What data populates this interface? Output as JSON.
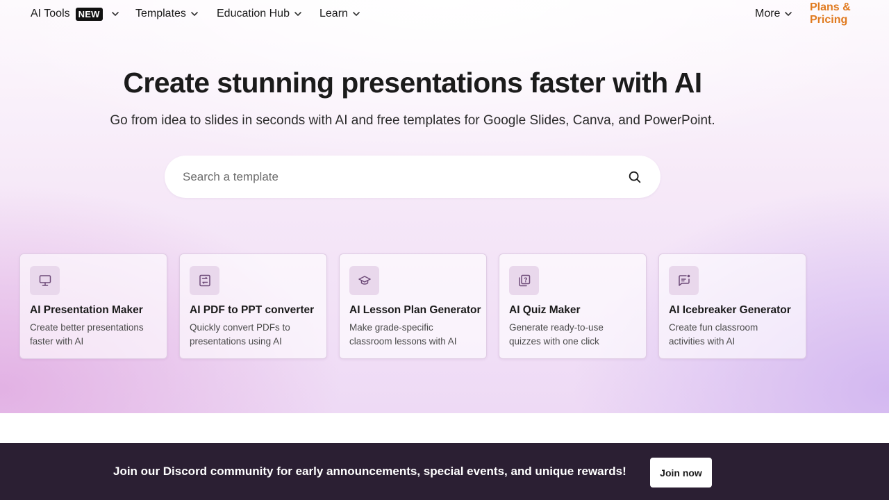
{
  "nav": {
    "ai_tools": "AI Tools",
    "new_badge": "NEW",
    "templates": "Templates",
    "education_hub": "Education Hub",
    "learn": "Learn",
    "more": "More",
    "pricing": "Plans & Pricing"
  },
  "hero": {
    "headline": "Create stunning presentations faster with AI",
    "subhead": "Go from idea to slides in seconds with AI and free templates for Google Slides, Canva, and PowerPoint."
  },
  "search": {
    "placeholder": "Search a template"
  },
  "cards": [
    {
      "title": "AI Presentation Maker",
      "desc": "Create better presentations faster with AI",
      "icon": "monitor-icon"
    },
    {
      "title": "AI PDF to PPT converter",
      "desc": "Quickly convert PDFs to presentations using AI",
      "icon": "convert-document-icon"
    },
    {
      "title": "AI Lesson Plan Generator",
      "desc": "Make grade-specific classroom lessons with AI",
      "icon": "graduation-cap-icon"
    },
    {
      "title": "AI Quiz Maker",
      "desc": "Generate ready-to-use quizzes with one click",
      "icon": "quiz-icon"
    },
    {
      "title": "AI Icebreaker Generator",
      "desc": "Create fun classroom activities with AI",
      "icon": "chat-bubble-icon"
    }
  ],
  "banner": {
    "text": "Join our Discord community for early announcements, special events, and unique rewards!",
    "button": "Join now"
  },
  "colors": {
    "accent_pricing": "#e07a1f",
    "banner_bg": "#2b1f33",
    "card_icon_bg": "#e9d8ec",
    "icon_stroke": "#6d4a78"
  }
}
